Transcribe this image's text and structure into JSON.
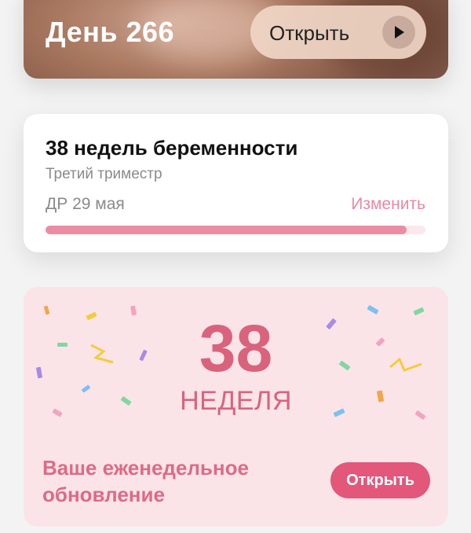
{
  "day_card": {
    "title": "День 266",
    "open_label": "Открыть",
    "play_icon": "play-icon"
  },
  "pregnancy_card": {
    "title": "38 недель беременности",
    "trimester": "Третий триместр",
    "due_date": "ДР 29 мая",
    "change_label": "Изменить",
    "progress_fraction": 0.95,
    "colors": {
      "progress_fill": "#ec8ca3",
      "progress_track": "#fbe8ec",
      "link": "#e68aa1"
    }
  },
  "week_card": {
    "week_number": "38",
    "week_label": "НЕДЕЛЯ",
    "update_text": "Ваше еженедельное обновление",
    "open_label": "Открыть",
    "colors": {
      "background": "#fbe4e8",
      "accent": "#d9637d",
      "button": "#e2577a"
    }
  }
}
